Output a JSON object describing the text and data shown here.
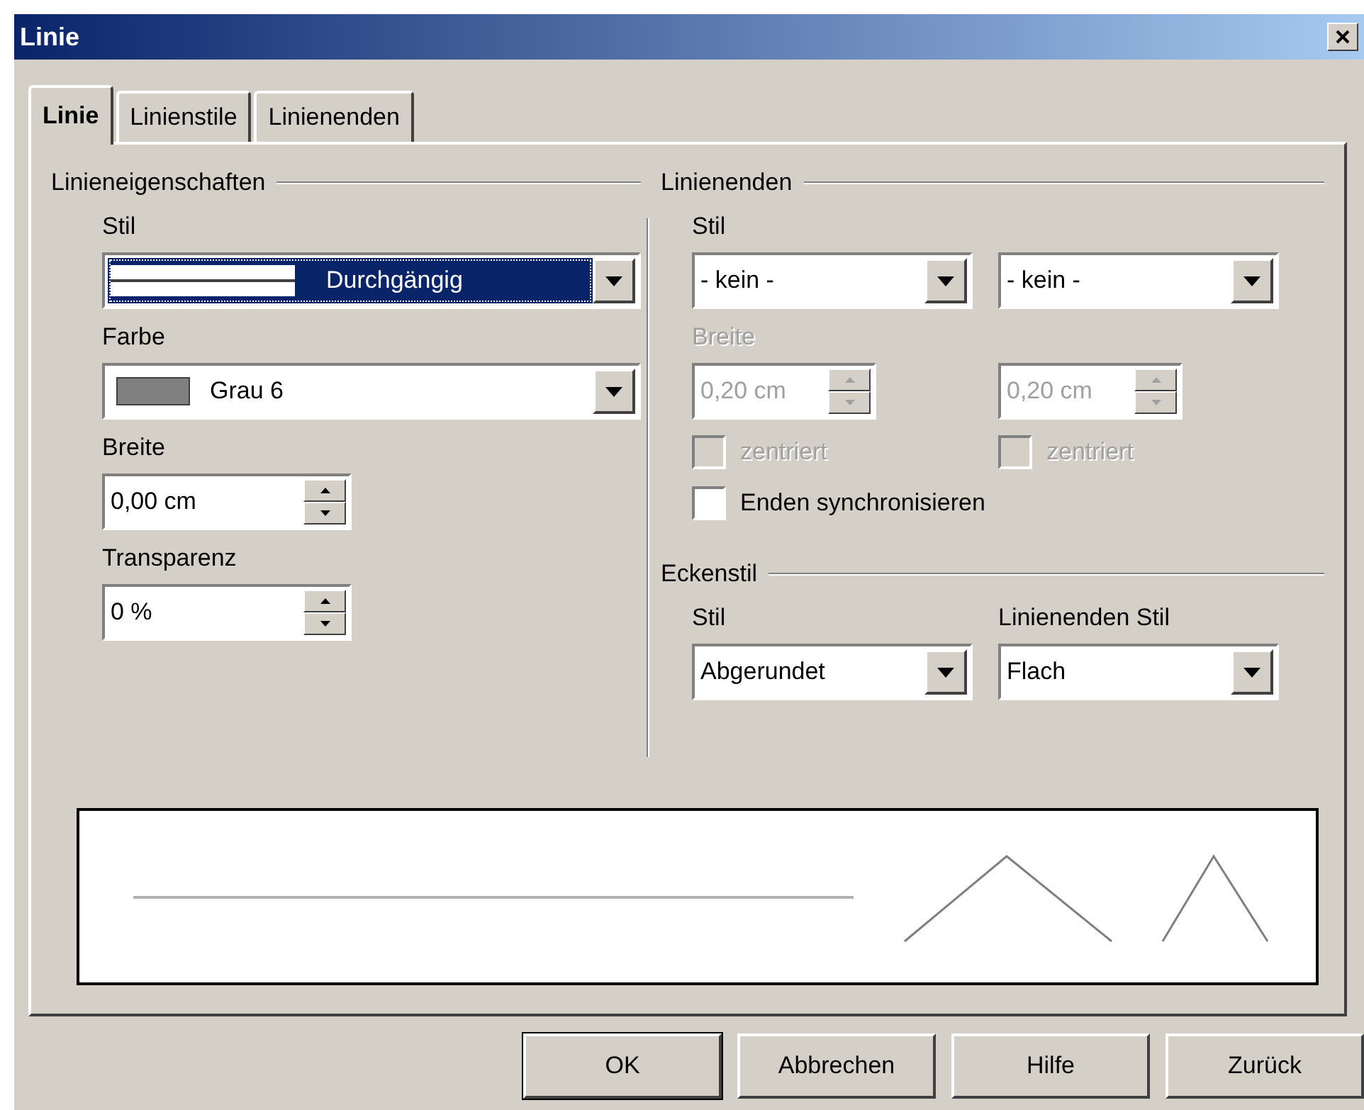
{
  "window": {
    "title": "Linie"
  },
  "tabs": [
    {
      "label": "Linie",
      "selected": true
    },
    {
      "label": "Linienstile",
      "selected": false
    },
    {
      "label": "Linienenden",
      "selected": false
    }
  ],
  "line_properties": {
    "title": "Linieneigenschaften",
    "style": {
      "label": "Stil",
      "value": "Durchgängig",
      "focused": true
    },
    "color": {
      "label": "Farbe",
      "value": "Grau 6",
      "color": "#808080"
    },
    "width": {
      "label": "Breite",
      "value": "0,00 cm"
    },
    "transparency": {
      "label": "Transparenz",
      "value": "0 %"
    }
  },
  "line_ends": {
    "title": "Linienenden",
    "style_label": "Stil",
    "styles": [
      {
        "value": "- kein -"
      },
      {
        "value": "- kein -"
      }
    ],
    "width_label": {
      "text": "Breite",
      "disabled": true
    },
    "widths": [
      {
        "value": "0,20 cm",
        "disabled": true
      },
      {
        "value": "0,20 cm",
        "disabled": true
      }
    ],
    "centered": [
      {
        "label": "zentriert",
        "checked": false,
        "disabled": true
      },
      {
        "label": "zentriert",
        "checked": false,
        "disabled": true
      }
    ],
    "synchronize": {
      "label": "Enden synchronisieren",
      "checked": false,
      "disabled": false
    }
  },
  "corner_style": {
    "title": "Eckenstil",
    "corner": {
      "label": "Stil",
      "value": "Abgerundet"
    },
    "cap": {
      "label": "Linienenden Stil",
      "value": "Flach"
    }
  },
  "buttons": [
    {
      "label": "OK",
      "default": true
    },
    {
      "label": "Abbrechen",
      "default": false
    },
    {
      "label": "Hilfe",
      "default": false
    },
    {
      "label": "Zurück",
      "default": false
    }
  ]
}
